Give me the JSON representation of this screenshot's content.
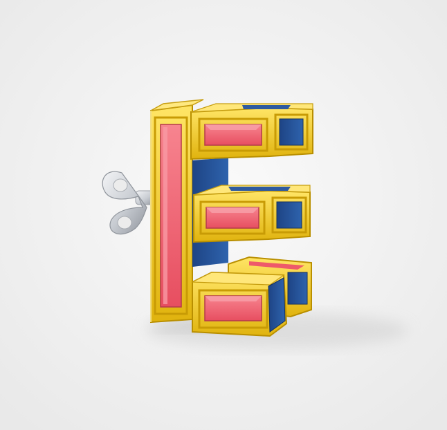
{
  "scene": {
    "subject": "letter-e-toy",
    "colors": {
      "background": "#f2f2f2",
      "frame": "#f0c419",
      "frame_dark": "#c99a00",
      "frame_light": "#ffe066",
      "panel_red": "#ee5a6a",
      "panel_red_light": "#f6808d",
      "panel_blue": "#27559c",
      "panel_blue_dark": "#1a3b72",
      "key_silver": "#c9ccd1"
    },
    "icons": {
      "wind_up_key": "key-icon"
    }
  }
}
